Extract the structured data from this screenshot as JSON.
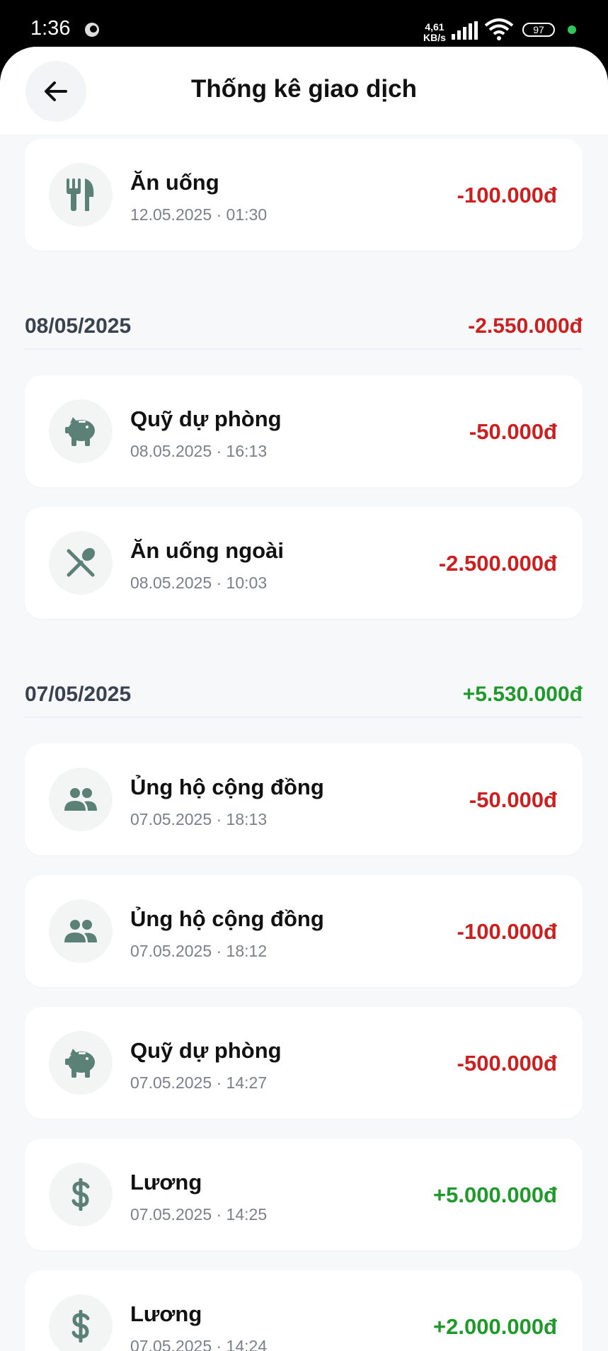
{
  "status_bar": {
    "time": "1:36",
    "speed_value": "4,61",
    "speed_unit": "KB/s",
    "battery": "97"
  },
  "header": {
    "title": "Thống kê giao dịch"
  },
  "colors": {
    "negative": "#cc1f1f",
    "positive": "#1f9a2a",
    "icon": "#5b8075"
  },
  "groups": [
    {
      "date": "08/05/2025",
      "total": "-2.550.000đ"
    },
    {
      "date": "07/05/2025",
      "total": "+5.530.000đ"
    }
  ],
  "transactions": [
    {
      "category": "Ăn uống",
      "datetime": "12.05.2025 · 01:30",
      "amount": "-100.000đ",
      "icon": "fork-knife-icon"
    },
    {
      "category": "Quỹ dự phòng",
      "datetime": "08.05.2025 · 16:13",
      "amount": "-50.000đ",
      "icon": "piggy-bank-icon"
    },
    {
      "category": "Ăn uống ngoài",
      "datetime": "08.05.2025 · 10:03",
      "amount": "-2.500.000đ",
      "icon": "dining-icon"
    },
    {
      "category": "Ủng hộ cộng đồng",
      "datetime": "07.05.2025 · 18:13",
      "amount": "-50.000đ",
      "icon": "people-icon"
    },
    {
      "category": "Ủng hộ cộng đồng",
      "datetime": "07.05.2025 · 18:12",
      "amount": "-100.000đ",
      "icon": "people-icon"
    },
    {
      "category": "Quỹ dự phòng",
      "datetime": "07.05.2025 · 14:27",
      "amount": "-500.000đ",
      "icon": "piggy-bank-icon"
    },
    {
      "category": "Lương",
      "datetime": "07.05.2025 · 14:25",
      "amount": "+5.000.000đ",
      "icon": "dollar-icon"
    },
    {
      "category": "Lương",
      "datetime": "07.05.2025 · 14:24",
      "amount": "+2.000.000đ",
      "icon": "dollar-icon"
    }
  ]
}
